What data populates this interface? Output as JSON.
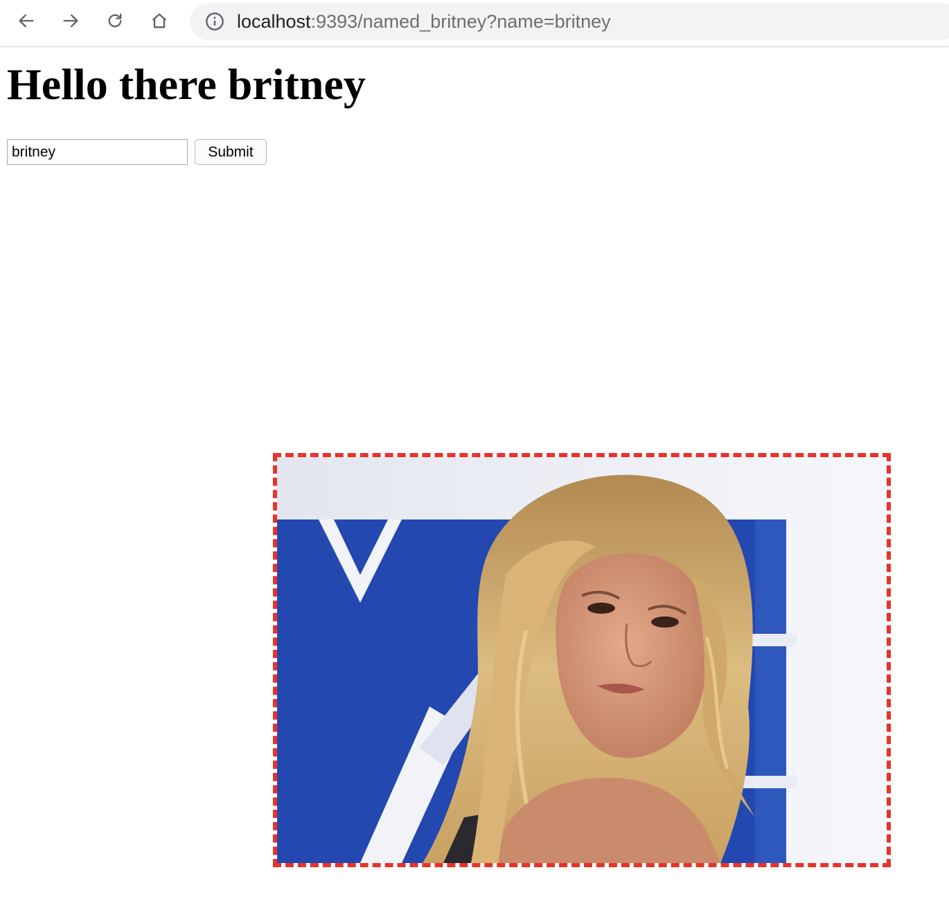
{
  "browser": {
    "url_host": "localhost",
    "url_rest": ":9393/named_britney?name=britney"
  },
  "page": {
    "heading": "Hello there britney",
    "form": {
      "name_value": "britney",
      "submit_label": "Submit"
    }
  },
  "icons": [
    "back-arrow-icon",
    "forward-arrow-icon",
    "reload-icon",
    "home-icon",
    "info-icon"
  ],
  "colors": {
    "frame_border": "#e8322a",
    "backdrop_blue": "#2348b0"
  }
}
